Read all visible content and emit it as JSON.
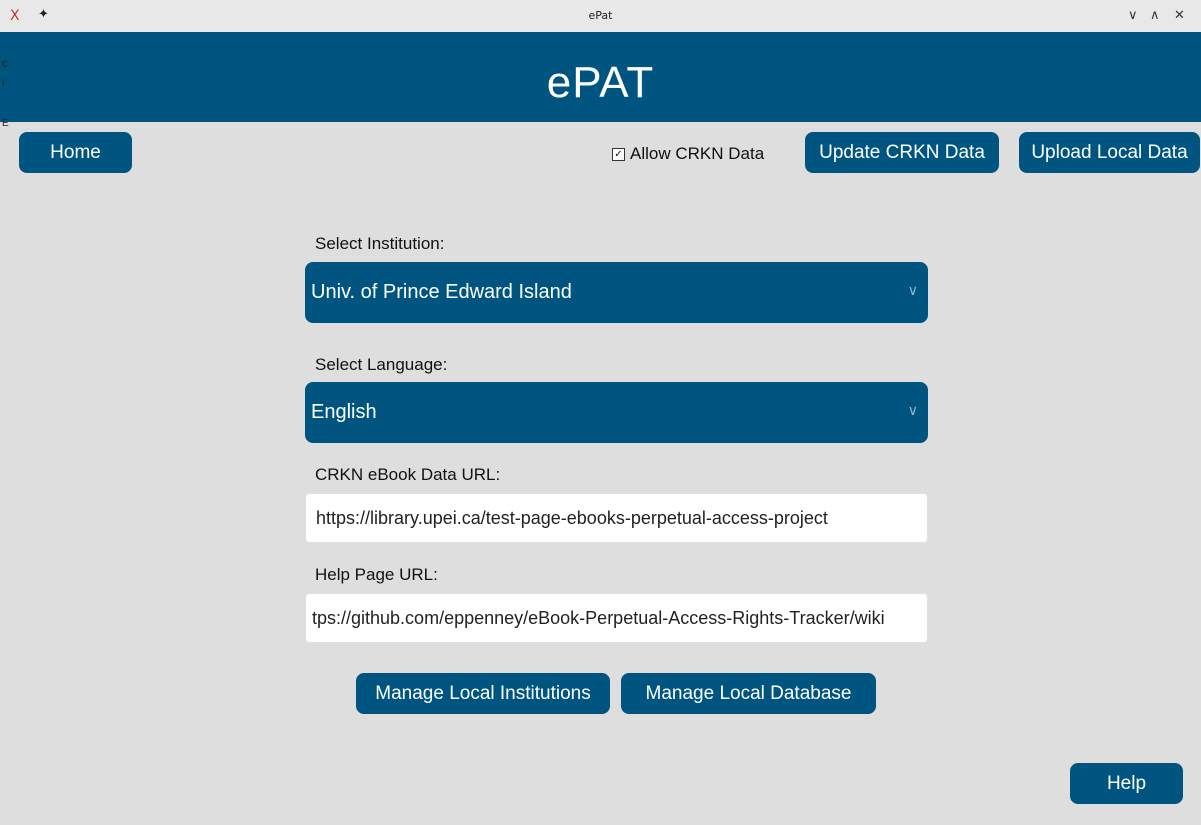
{
  "titlebar": {
    "title": "ePat",
    "app_icon": "X",
    "pin_icon": "📌",
    "min_icon": "∨",
    "max_icon": "∧",
    "close_icon": "✕"
  },
  "header": {
    "app_title": "ePAT"
  },
  "stray_text": {
    "a": "c",
    "b": "i",
    "c": "E"
  },
  "toolbar": {
    "home_label": "Home",
    "allow_crkn_label": "Allow CRKN Data",
    "allow_crkn_checked": true,
    "update_crkn_label": "Update CRKN Data",
    "upload_local_label": "Upload Local Data"
  },
  "form": {
    "institution_label": "Select Institution:",
    "institution_value": "Univ. of Prince Edward Island",
    "language_label": "Select Language:",
    "language_value": "English",
    "crkn_url_label": "CRKN eBook Data URL:",
    "crkn_url_value": "https://library.upei.ca/test-page-ebooks-perpetual-access-project",
    "help_url_label": "Help Page URL:",
    "help_url_value": "tps://github.com/eppenney/eBook-Perpetual-Access-Rights-Tracker/wiki"
  },
  "actions": {
    "manage_institutions_label": "Manage Local Institutions",
    "manage_database_label": "Manage Local Database",
    "help_label": "Help"
  },
  "colors": {
    "accent": "#005480",
    "background": "#dedede"
  }
}
